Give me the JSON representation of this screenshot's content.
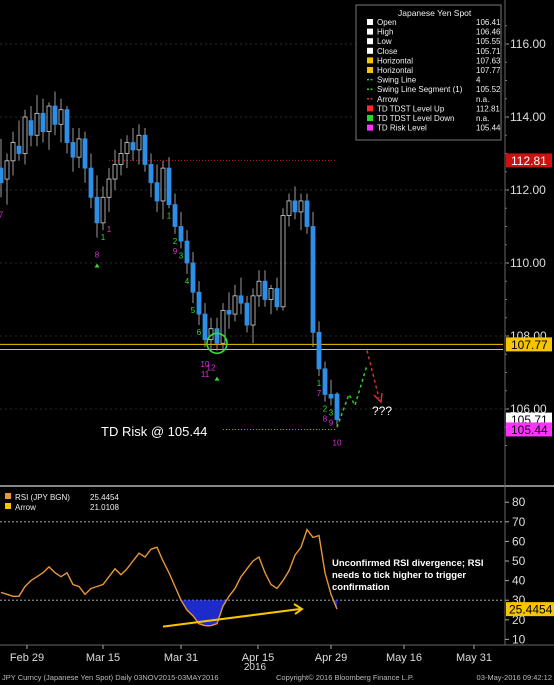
{
  "legend_top": {
    "title": "Japanese Yen Spot",
    "rows": [
      {
        "name": "Open",
        "value": "106.41",
        "swatch": "#ffffff",
        "kind": "box"
      },
      {
        "name": "High",
        "value": "106.46",
        "swatch": "#ffffff",
        "kind": "box"
      },
      {
        "name": "Low",
        "value": "105.55",
        "swatch": "#ffffff",
        "kind": "box"
      },
      {
        "name": "Close",
        "value": "105.71",
        "swatch": "#ffffff",
        "kind": "box"
      },
      {
        "name": "Horizontal",
        "value": "107.63",
        "swatch": "#f5c500",
        "kind": "box"
      },
      {
        "name": "Horizontal",
        "value": "107.77",
        "swatch": "#f5c500",
        "kind": "box"
      },
      {
        "name": "Swing Line",
        "value": "4",
        "swatch": "#33cc33",
        "kind": "dash"
      },
      {
        "name": "Swing Line Segment (1)",
        "value": "105.52",
        "swatch": "#33cc33",
        "kind": "dash"
      },
      {
        "name": "Arrow",
        "value": "n.a.",
        "swatch": "#cc3333",
        "kind": "dash"
      },
      {
        "name": "TD TDST Level Up",
        "value": "112.81",
        "swatch": "#ff2a2a",
        "kind": "box"
      },
      {
        "name": "TD TDST Level Down",
        "value": "n.a.",
        "swatch": "#22dd22",
        "kind": "box"
      },
      {
        "name": "TD Risk Level",
        "value": "105.44",
        "swatch": "#ff33ff",
        "kind": "box"
      }
    ]
  },
  "legend_rsi": {
    "rows": [
      {
        "name": "RSI (JPY BGN)",
        "value": "25.4454",
        "swatch": "#e8963a"
      },
      {
        "name": "Arrow",
        "value": "21.0108",
        "swatch": "#f5c500"
      }
    ]
  },
  "annotations": {
    "td_risk": "TD Risk @ 105.44",
    "question": "???",
    "rsi_note": [
      "Unconfirmed RSI divergence; RSI",
      "needs to tick higher to trigger",
      "confirmation"
    ]
  },
  "price_tags": [
    {
      "value": 112.81,
      "label": "112.81",
      "bg": "#cc1111",
      "fg": "#ffffff"
    },
    {
      "value": 107.77,
      "label": "107.77",
      "bg": "#f5c500",
      "fg": "#000000"
    },
    {
      "value": 105.71,
      "label": "105.71",
      "bg": "#ffffff",
      "fg": "#000000"
    },
    {
      "value": 105.44,
      "label": "105.44",
      "bg": "#ff33ff",
      "fg": "#000000"
    }
  ],
  "rsi_tag": {
    "value": 25.4454,
    "label": "25.4454",
    "bg": "#f5c500",
    "fg": "#000000"
  },
  "footer": {
    "left": "JPY Curncy (Japanese Yen Spot)  Daily 03NOV2015-03MAY2016",
    "center": "Copyright© 2016 Bloomberg Finance L.P.",
    "right": "03-May-2016 09:42:12"
  },
  "chart_data": [
    {
      "type": "candlestick",
      "title": "Japanese Yen Spot",
      "ylim": [
        104.0,
        117.0
      ],
      "yticks": [
        106,
        108,
        110,
        112,
        114,
        116
      ],
      "ytick_labels": [
        "106.00",
        "108.00",
        "110.00",
        "112.00",
        "114.00",
        "116.00"
      ],
      "x_labels": [
        "Feb 29",
        "Mar 15",
        "Mar 31",
        "Apr 15",
        "Apr 29",
        "May 16",
        "May 31"
      ],
      "x_sublabel": "2016",
      "candles": [
        {
          "o": 112.6,
          "h": 113.4,
          "l": 111.8,
          "c": 112.2
        },
        {
          "o": 112.3,
          "h": 113.0,
          "l": 111.6,
          "c": 112.8
        },
        {
          "o": 112.8,
          "h": 113.6,
          "l": 112.4,
          "c": 113.3
        },
        {
          "o": 113.2,
          "h": 113.9,
          "l": 112.8,
          "c": 113.0
        },
        {
          "o": 113.0,
          "h": 114.2,
          "l": 112.7,
          "c": 114.0
        },
        {
          "o": 113.9,
          "h": 114.3,
          "l": 113.2,
          "c": 113.5
        },
        {
          "o": 113.5,
          "h": 114.6,
          "l": 113.2,
          "c": 114.1
        },
        {
          "o": 114.1,
          "h": 114.5,
          "l": 113.3,
          "c": 113.6
        },
        {
          "o": 113.6,
          "h": 114.4,
          "l": 113.1,
          "c": 114.3
        },
        {
          "o": 114.3,
          "h": 114.7,
          "l": 113.5,
          "c": 113.8
        },
        {
          "o": 113.8,
          "h": 114.5,
          "l": 113.3,
          "c": 114.2
        },
        {
          "o": 114.2,
          "h": 114.3,
          "l": 113.0,
          "c": 113.3
        },
        {
          "o": 113.3,
          "h": 113.7,
          "l": 112.5,
          "c": 112.9
        },
        {
          "o": 112.9,
          "h": 113.7,
          "l": 112.6,
          "c": 113.4
        },
        {
          "o": 113.4,
          "h": 113.6,
          "l": 112.2,
          "c": 112.6
        },
        {
          "o": 112.6,
          "h": 113.0,
          "l": 111.5,
          "c": 111.8
        },
        {
          "o": 111.8,
          "h": 112.4,
          "l": 110.7,
          "c": 111.1
        },
        {
          "o": 111.1,
          "h": 112.1,
          "l": 110.9,
          "c": 111.8
        },
        {
          "o": 111.8,
          "h": 112.6,
          "l": 111.4,
          "c": 112.3
        },
        {
          "o": 112.3,
          "h": 113.1,
          "l": 112.0,
          "c": 112.7
        },
        {
          "o": 112.7,
          "h": 113.4,
          "l": 112.4,
          "c": 113.0
        },
        {
          "o": 113.0,
          "h": 113.5,
          "l": 112.6,
          "c": 113.3
        },
        {
          "o": 113.3,
          "h": 113.7,
          "l": 112.8,
          "c": 113.1
        },
        {
          "o": 113.1,
          "h": 113.8,
          "l": 112.7,
          "c": 113.5
        },
        {
          "o": 113.5,
          "h": 113.7,
          "l": 112.5,
          "c": 112.7
        },
        {
          "o": 112.7,
          "h": 113.0,
          "l": 111.8,
          "c": 112.2
        },
        {
          "o": 112.2,
          "h": 112.7,
          "l": 111.4,
          "c": 111.7
        },
        {
          "o": 111.7,
          "h": 112.8,
          "l": 111.2,
          "c": 112.6
        },
        {
          "o": 112.6,
          "h": 112.9,
          "l": 111.5,
          "c": 111.6
        },
        {
          "o": 111.6,
          "h": 111.9,
          "l": 110.8,
          "c": 111.0
        },
        {
          "o": 111.0,
          "h": 111.4,
          "l": 110.4,
          "c": 110.6
        },
        {
          "o": 110.6,
          "h": 110.9,
          "l": 109.7,
          "c": 110.0
        },
        {
          "o": 110.0,
          "h": 110.3,
          "l": 108.9,
          "c": 109.2
        },
        {
          "o": 109.2,
          "h": 109.5,
          "l": 108.3,
          "c": 108.6
        },
        {
          "o": 108.6,
          "h": 108.9,
          "l": 107.7,
          "c": 107.9
        },
        {
          "o": 107.9,
          "h": 108.5,
          "l": 107.6,
          "c": 108.2
        },
        {
          "o": 108.2,
          "h": 108.5,
          "l": 107.6,
          "c": 107.8
        },
        {
          "o": 107.8,
          "h": 108.9,
          "l": 107.6,
          "c": 108.7
        },
        {
          "o": 108.7,
          "h": 109.2,
          "l": 108.2,
          "c": 108.6
        },
        {
          "o": 108.6,
          "h": 109.4,
          "l": 108.4,
          "c": 109.1
        },
        {
          "o": 109.1,
          "h": 109.6,
          "l": 108.6,
          "c": 108.9
        },
        {
          "o": 108.9,
          "h": 109.1,
          "l": 108.1,
          "c": 108.3
        },
        {
          "o": 108.3,
          "h": 109.3,
          "l": 107.8,
          "c": 109.1
        },
        {
          "o": 109.1,
          "h": 109.8,
          "l": 108.8,
          "c": 109.5
        },
        {
          "o": 109.5,
          "h": 109.8,
          "l": 108.8,
          "c": 109.0
        },
        {
          "o": 109.0,
          "h": 109.4,
          "l": 108.6,
          "c": 109.3
        },
        {
          "o": 109.3,
          "h": 109.6,
          "l": 108.7,
          "c": 108.8
        },
        {
          "o": 108.8,
          "h": 111.5,
          "l": 108.7,
          "c": 111.3
        },
        {
          "o": 111.3,
          "h": 111.9,
          "l": 111.0,
          "c": 111.7
        },
        {
          "o": 111.7,
          "h": 112.1,
          "l": 111.2,
          "c": 111.4
        },
        {
          "o": 111.4,
          "h": 111.9,
          "l": 110.9,
          "c": 111.7
        },
        {
          "o": 111.7,
          "h": 111.9,
          "l": 110.8,
          "c": 111.0
        },
        {
          "o": 111.0,
          "h": 111.4,
          "l": 107.7,
          "c": 108.1
        },
        {
          "o": 108.1,
          "h": 108.4,
          "l": 106.9,
          "c": 107.1
        },
        {
          "o": 107.1,
          "h": 107.3,
          "l": 106.2,
          "c": 106.4
        },
        {
          "o": 106.4,
          "h": 106.8,
          "l": 106.1,
          "c": 106.3
        },
        {
          "o": 106.41,
          "h": 106.46,
          "l": 105.55,
          "c": 105.71
        }
      ],
      "td_counts_green": [
        {
          "i": 17,
          "t": "1"
        },
        {
          "i": 28,
          "t": "1"
        },
        {
          "i": 29,
          "t": "2"
        },
        {
          "i": 30,
          "t": "3"
        },
        {
          "i": 31,
          "t": "4"
        },
        {
          "i": 32,
          "t": "5"
        },
        {
          "i": 33,
          "t": "6"
        },
        {
          "i": 53,
          "t": "1"
        },
        {
          "i": 54,
          "t": "2"
        },
        {
          "i": 55,
          "t": "3"
        }
      ],
      "td_counts_magenta": [
        {
          "i": 0,
          "t": "7"
        },
        {
          "i": 16,
          "t": "8"
        },
        {
          "i": 18,
          "t": "1"
        },
        {
          "i": 29,
          "t": "9"
        },
        {
          "i": 34,
          "t": "10"
        },
        {
          "i": 34,
          "t": "11"
        },
        {
          "i": 35,
          "t": "12"
        },
        {
          "i": 53,
          "t": "7"
        },
        {
          "i": 54,
          "t": "8"
        },
        {
          "i": 55,
          "t": "9"
        },
        {
          "i": 56,
          "t": "10"
        }
      ],
      "tdst_level_up": 112.81,
      "horizontal_levels": [
        107.63,
        107.77
      ],
      "td_risk_level": 105.44,
      "swing_line": [
        [
          56,
          105.5
        ],
        [
          58,
          106.4
        ],
        [
          59,
          106.1
        ],
        [
          61,
          107.2
        ]
      ],
      "arrow": [
        [
          61,
          107.6
        ],
        [
          63,
          106.3
        ]
      ]
    },
    {
      "type": "line",
      "name": "RSI (JPY BGN)",
      "ylim": [
        10,
        85
      ],
      "yticks": [
        10,
        20,
        30,
        40,
        50,
        60,
        70,
        80
      ],
      "ytick_labels": [
        "10",
        "20",
        "30",
        "40",
        "50",
        "60",
        "70",
        "80"
      ],
      "reference_lines": [
        70,
        30
      ],
      "x_labels": [
        "Feb 29",
        "Mar 15",
        "Mar 31",
        "Apr 15",
        "Apr 29",
        "May 16",
        "May 31"
      ],
      "x_sublabel": "2016",
      "values": [
        34,
        33,
        32,
        32,
        37,
        40,
        42,
        44,
        47,
        44,
        42,
        44,
        38,
        37,
        33,
        36,
        37,
        38,
        42,
        46,
        43,
        46,
        50,
        54,
        52,
        56,
        57,
        50,
        44,
        37,
        30,
        25,
        22,
        18,
        17,
        17,
        18,
        27,
        32,
        36,
        42,
        46,
        50,
        52,
        44,
        38,
        36,
        40,
        45,
        53,
        57,
        66,
        62,
        63,
        44,
        33,
        25.4454
      ],
      "divergence_arrow": [
        [
          27,
          16.5
        ],
        [
          49,
          25.5
        ]
      ]
    }
  ]
}
